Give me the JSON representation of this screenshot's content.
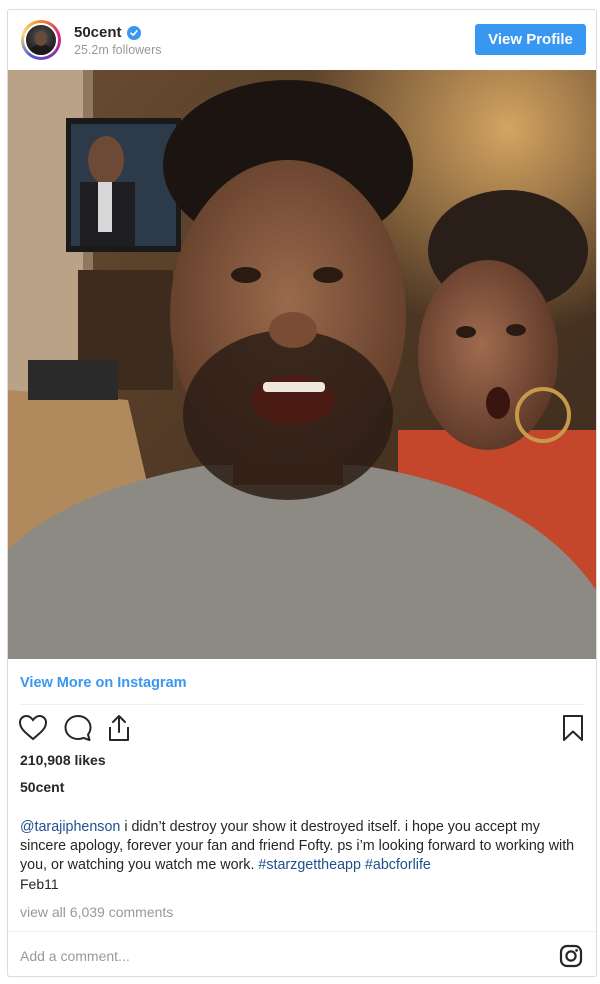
{
  "header": {
    "username": "50cent",
    "followers": "25.2m followers",
    "view_profile_label": "View Profile"
  },
  "post": {
    "view_more_label": "View More on Instagram",
    "likes": "210,908 likes",
    "author": "50cent",
    "caption": {
      "mention": "@tarajiphenson",
      "text": " i didn’t destroy your show it destroyed itself. i hope you accept my sincere apology, forever your fan and friend Fofty. ps i’m looking forward to working with you, or watching you watch me work. ",
      "hashtag1": "#starzgettheapp",
      "hashtag2": "#abcforlife"
    },
    "date": "Feb11",
    "view_comments": "view all 6,039 comments",
    "add_comment_placeholder": "Add a comment..."
  },
  "icons": {
    "verified": "verified-badge-icon",
    "like": "heart-icon",
    "comment": "comment-bubble-icon",
    "share": "share-icon",
    "save": "bookmark-icon",
    "instagram": "instagram-logo-icon"
  },
  "colors": {
    "accent": "#3897f0",
    "hashtag": "#1f4f8f",
    "muted": "#999999",
    "border": "#dbdbdb"
  }
}
